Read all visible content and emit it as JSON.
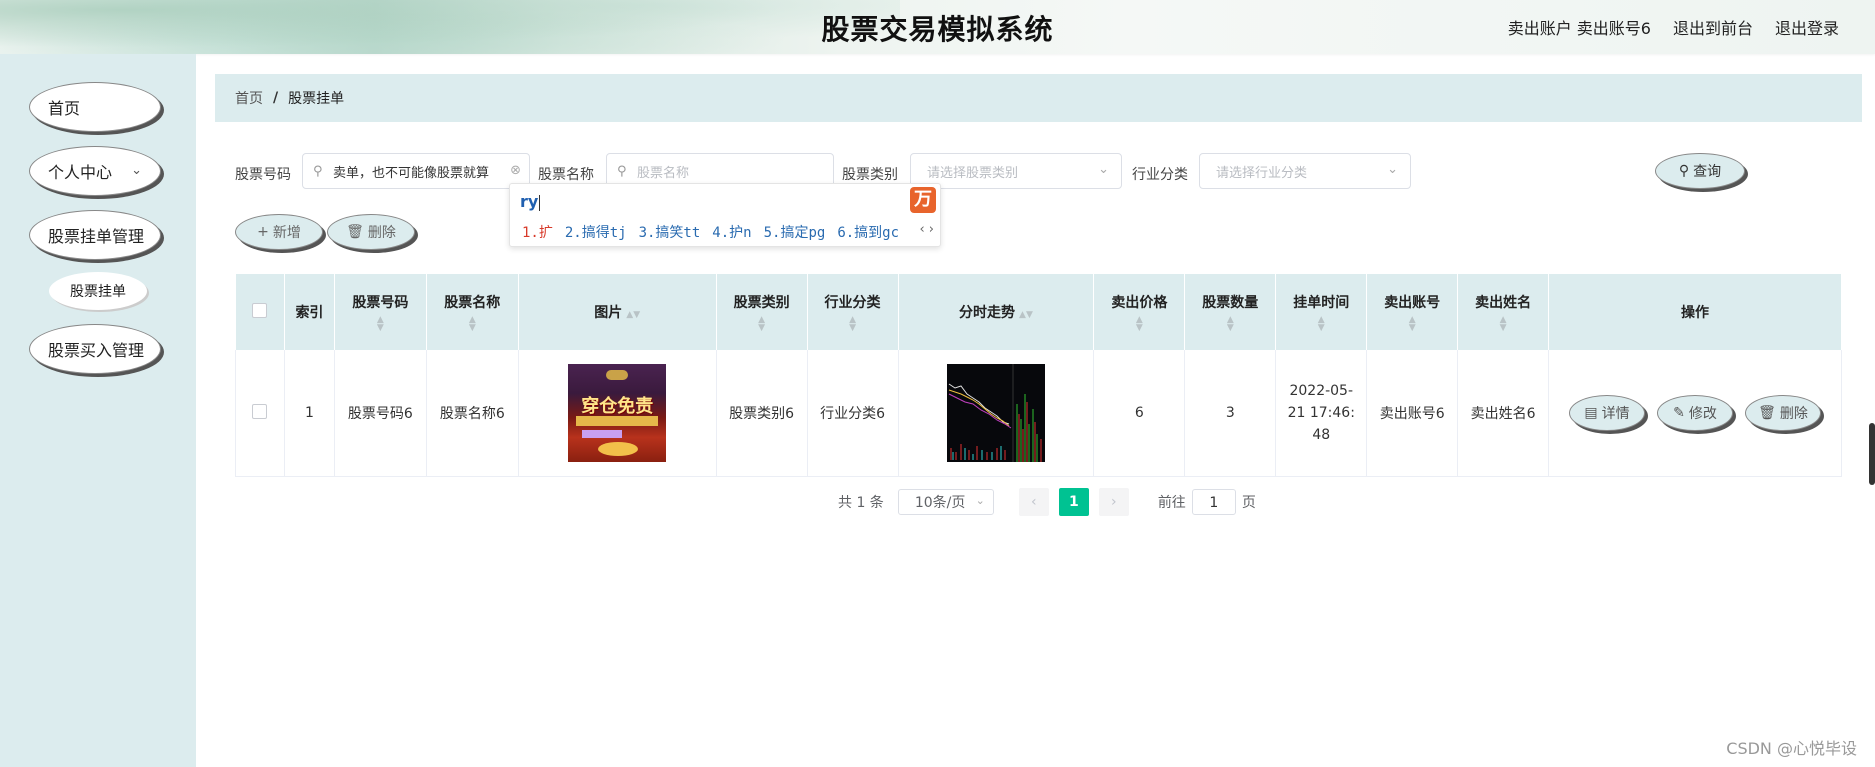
{
  "header": {
    "title": "股票交易模拟系统",
    "user_label": "卖出账户 卖出账号6",
    "front_link": "退出到前台",
    "logout_link": "退出登录"
  },
  "sidebar": {
    "items": [
      {
        "label": "首页"
      },
      {
        "label": "个人中心"
      },
      {
        "label": "股票挂单管理"
      },
      {
        "label": "股票挂单"
      },
      {
        "label": "股票买入管理"
      }
    ],
    "chevron_icon": "chevron-down-icon"
  },
  "breadcrumb": {
    "home": "首页",
    "separator": "/",
    "current": "股票挂单"
  },
  "search": {
    "code_label": "股票号码",
    "code_value": "卖单，也不可能像股票就算",
    "name_label": "股票名称",
    "name_placeholder": "股票名称",
    "type_label": "股票类别",
    "type_placeholder": "请选择股票类别",
    "industry_label": "行业分类",
    "industry_placeholder": "请选择行业分类",
    "query_button": "查询"
  },
  "ime": {
    "typed": "ry",
    "candidates": [
      "1.扩",
      "2.搞得tj",
      "3.搞笑tt",
      "4.护n",
      "5.搞定pg",
      "6.搞到gc"
    ],
    "logo": "万"
  },
  "actions": {
    "add": "新增",
    "delete": "删除"
  },
  "table": {
    "headers": {
      "index": "索引",
      "code": "股票号码",
      "name": "股票名称",
      "image": "图片",
      "type": "股票类别",
      "industry": "行业分类",
      "trend": "分时走势",
      "price": "卖出价格",
      "qty": "股票数量",
      "time": "挂单时间",
      "account": "卖出账号",
      "seller": "卖出姓名",
      "ops": "操作"
    },
    "rows": [
      {
        "index": "1",
        "code": "股票号码6",
        "name": "股票名称6",
        "image_text": "穿仓免责",
        "type": "股票类别6",
        "industry": "行业分类6",
        "price": "6",
        "qty": "3",
        "time": "2022-05-21 17:46:48",
        "account": "卖出账号6",
        "seller": "卖出姓名6",
        "detail": "详情",
        "edit": "修改",
        "delete": "删除"
      }
    ]
  },
  "pagination": {
    "total": "共 1 条",
    "page_size": "10条/页",
    "current": "1",
    "goto_label": "前往",
    "goto_value": "1",
    "page_suffix": "页"
  },
  "watermark": "CSDN @心悦毕设",
  "colors": {
    "panel": "#dcecee",
    "accent": "#00c292"
  }
}
